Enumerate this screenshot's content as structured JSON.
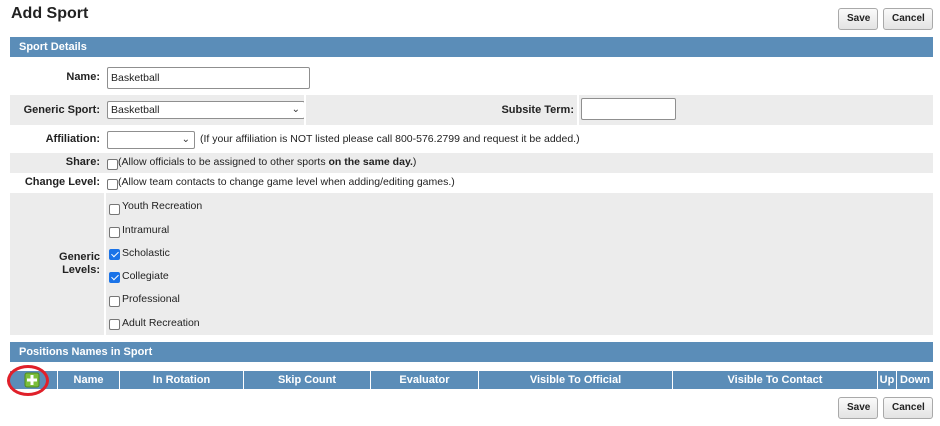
{
  "page": {
    "title": "Add Sport"
  },
  "buttons": {
    "save": "Save",
    "cancel": "Cancel"
  },
  "sport_details": {
    "header": "Sport Details",
    "name": {
      "label": "Name:",
      "value": "Basketball"
    },
    "generic_sport": {
      "label": "Generic Sport:",
      "value": "Basketball"
    },
    "subsite_term": {
      "label": "Subsite Term:",
      "value": ""
    },
    "affiliation": {
      "label": "Affiliation:",
      "value": "",
      "note": "(If your affiliation is NOT listed please call 800-576.2799 and request it be added.)"
    },
    "share": {
      "label": "Share:",
      "note_pre": "(Allow officials to be assigned to other sports ",
      "note_bold": "on the same day.",
      "note_post": ")",
      "checked": false
    },
    "change_level": {
      "label": "Change Level:",
      "note": "(Allow team contacts to change game level when adding/editing games.)",
      "checked": false
    },
    "generic_levels": {
      "label_line1": "Generic",
      "label_line2": "Levels:",
      "options": [
        {
          "label": "Youth Recreation",
          "checked": false
        },
        {
          "label": "Intramural",
          "checked": false
        },
        {
          "label": "Scholastic",
          "checked": true
        },
        {
          "label": "Collegiate",
          "checked": true
        },
        {
          "label": "Professional",
          "checked": false
        },
        {
          "label": "Adult Recreation",
          "checked": false
        }
      ]
    }
  },
  "positions": {
    "header": "Positions Names in Sport",
    "columns": [
      "Name",
      "In Rotation",
      "Skip Count",
      "Evaluator",
      "Visible To Official",
      "Visible To Contact",
      "Up",
      "Down"
    ],
    "add_icon": "plus-icon",
    "highlight_color": "#e0202a"
  },
  "colors": {
    "header_bg": "#5b8db8",
    "row_shade": "#ececec",
    "checkbox_checked": "#1a73e8"
  }
}
